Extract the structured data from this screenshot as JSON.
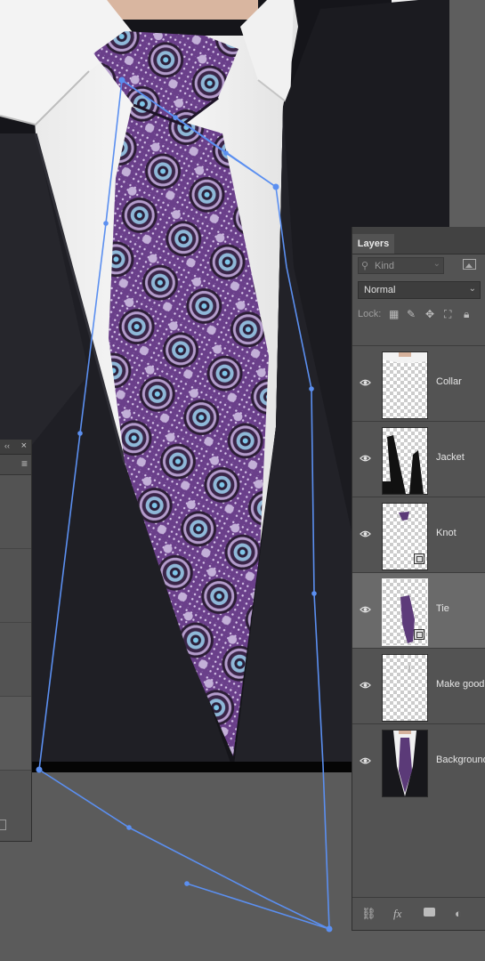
{
  "layers_panel": {
    "tab_label": "Layers",
    "filter_placeholder": "Kind",
    "blend_mode": "Normal",
    "lock_label": "Lock:",
    "layers": [
      {
        "name": "Collar",
        "visible": true,
        "selected": false,
        "smart_object": false
      },
      {
        "name": "Jacket",
        "visible": true,
        "selected": false,
        "smart_object": false
      },
      {
        "name": "Knot",
        "visible": true,
        "selected": false,
        "smart_object": true
      },
      {
        "name": "Tie",
        "visible": true,
        "selected": true,
        "smart_object": true
      },
      {
        "name": "Make good",
        "visible": true,
        "selected": false,
        "smart_object": false
      },
      {
        "name": "Background",
        "visible": true,
        "selected": false,
        "smart_object": false
      }
    ],
    "footer_icons": [
      "link-layers-icon",
      "fx-icon",
      "mask-icon",
      "adjustment-icon"
    ]
  },
  "left_panel": {
    "collapse_glyph": "‹‹",
    "close_glyph": "×"
  },
  "colors": {
    "path": "#5b8ff0",
    "panel": "#535353",
    "selected_layer": "#6a6a6a",
    "workspace": "#5b5b5b"
  }
}
